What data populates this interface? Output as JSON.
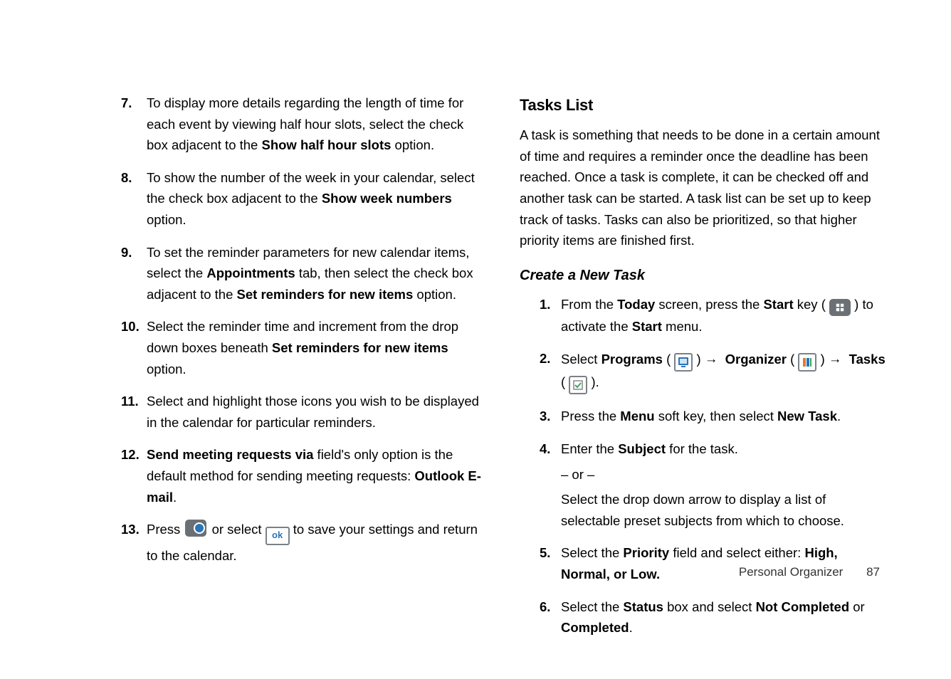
{
  "left": {
    "items": [
      {
        "num": "7.",
        "text_a": "To display more details regarding the length of time for each event by viewing half hour slots, select the check box adjacent to the ",
        "bold_a": "Show half hour slots",
        "text_b": " option."
      },
      {
        "num": "8.",
        "text_a": "To show the number of the week in your calendar, select the check box adjacent to the ",
        "bold_a": "Show week numbers",
        "text_b": " option."
      },
      {
        "num": "9.",
        "text_a": "To set the reminder parameters for new calendar items, select the ",
        "bold_a": "Appointments",
        "text_b": " tab, then select the check box adjacent to the ",
        "bold_b": "Set reminders for new items",
        "text_c": " option."
      },
      {
        "num": "10.",
        "text_a": "Select the reminder time and increment from the drop down boxes beneath ",
        "bold_a": "Set reminders for new items",
        "text_b": " option."
      },
      {
        "num": "11.",
        "text_a": "Select and highlight those icons you wish to be displayed in the calendar for particular reminders."
      },
      {
        "num": "12.",
        "bold_lead": "Send meeting requests via",
        "text_a": " field's only option is the default method for sending meeting requests: ",
        "bold_b": "Outlook E-mail",
        "text_b": "."
      },
      {
        "num": "13.",
        "text_a": "Press ",
        "icon_a": "ok-badge",
        "text_b": " or select ",
        "icon_b": "ok-box",
        "text_c": " to save your settings and return to the calendar."
      }
    ]
  },
  "right": {
    "section_title": "Tasks List",
    "para": "A task is something that needs to be done in a certain amount of time and requires a reminder once the deadline has been reached. Once a task is complete, it can be checked off and another task can be started. A task list can be set up to keep track of tasks. Tasks can also be prioritized, so that higher priority items are finished first.",
    "subhead": "Create a New Task",
    "steps": {
      "s1": {
        "num": "1.",
        "a": "From the ",
        "b1": "Today",
        "c": " screen, press the ",
        "b2": "Start",
        "d": " key ( ",
        "e": " ) to activate the ",
        "b3": "Start",
        "f": " menu."
      },
      "s2": {
        "num": "2.",
        "a": "Select ",
        "b1": "Programs",
        "p1": " ( ",
        "p2": ") ",
        "arrow": "→",
        "b2": "Organizer",
        "p3": " ( ",
        "p4": " ) ",
        "b3": "Tasks",
        "p5": "( ",
        "p6": " )."
      },
      "s3": {
        "num": "3.",
        "a": "Press the ",
        "b1": "Menu",
        "b": " soft key, then select ",
        "b2": "New Task",
        "c": "."
      },
      "s4": {
        "num": "4.",
        "a": "Enter the ",
        "b1": "Subject",
        "b": " for the task.",
        "or": "– or –",
        "sub": "Select the drop down arrow to display a list of selectable preset subjects from which to choose."
      },
      "s5": {
        "num": "5.",
        "a": "Select the ",
        "b1": "Priority",
        "b": " field and select either: ",
        "b2": "High, Normal, or Low."
      },
      "s6": {
        "num": "6.",
        "a": "Select the ",
        "b1": "Status",
        "b": " box and select ",
        "b2": "Not Completed",
        "c": " or ",
        "b3": "Completed",
        "d": "."
      }
    }
  },
  "footer": {
    "section": "Personal Organizer",
    "page": "87"
  },
  "ok_label": "ok"
}
